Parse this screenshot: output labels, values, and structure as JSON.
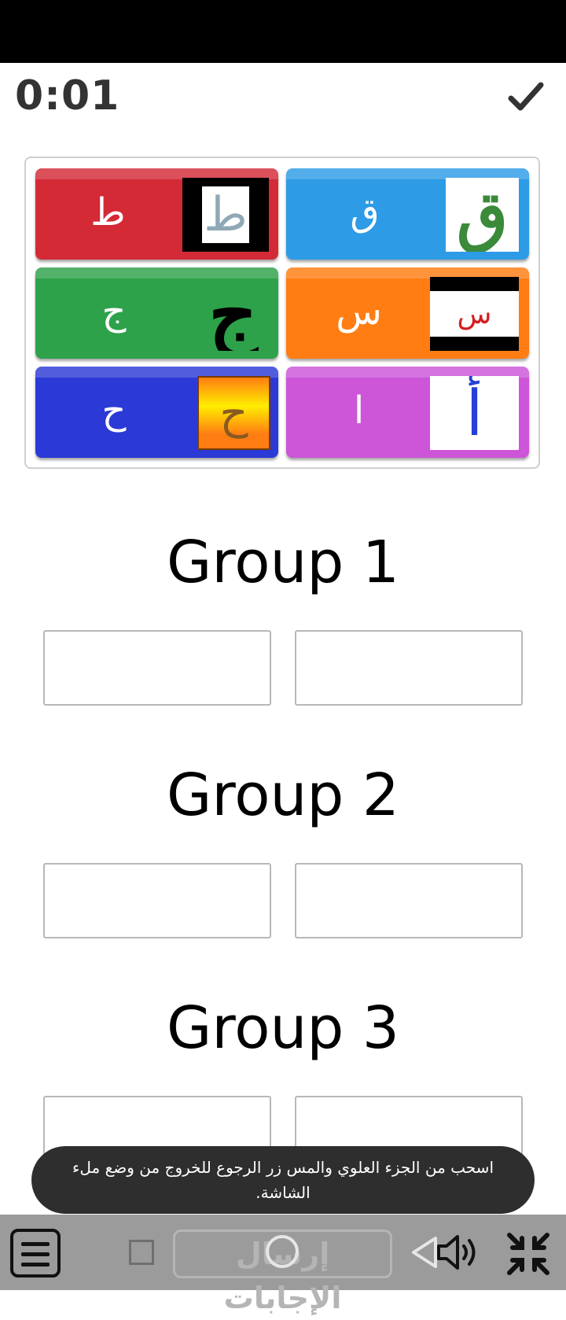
{
  "timer": "0:01",
  "icons": {
    "submit_check": "check-icon",
    "menu": "hamburger-menu-icon",
    "sound": "speaker-icon",
    "fullscreen": "exit-fullscreen-icon"
  },
  "cards": [
    {
      "label": "ط",
      "image_letter": "ط",
      "color": "#d42a36"
    },
    {
      "label": "ق",
      "image_letter": "ق",
      "color": "#2d9be6"
    },
    {
      "label": "ج",
      "image_letter": "ج",
      "color": "#2da24a"
    },
    {
      "label": "س",
      "image_letter": "س",
      "color": "#ff7d12"
    },
    {
      "label": "ح",
      "image_letter": "ح",
      "color": "#2b3ad6"
    },
    {
      "label": "ا",
      "image_letter": "أ",
      "color": "#cc55d8"
    }
  ],
  "groups": [
    {
      "title": "Group 1"
    },
    {
      "title": "Group 2"
    },
    {
      "title": "Group 3"
    }
  ],
  "toast": "اسحب من الجزء العلوي والمس زر الرجوع للخروج من وضع ملء الشاشة.",
  "bottom_bar": {
    "submit_label": "إرسال الإجابات"
  }
}
